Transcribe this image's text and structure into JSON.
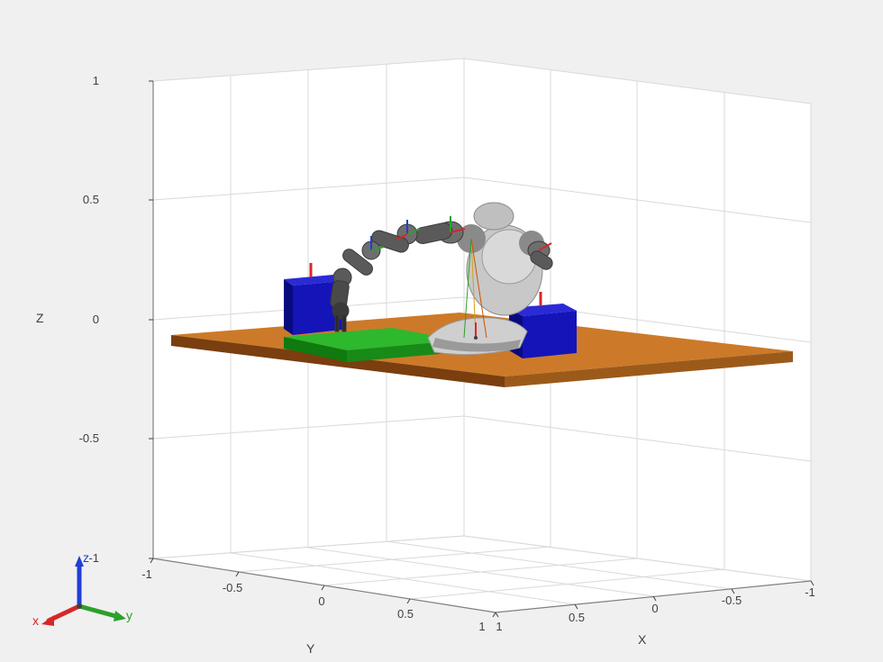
{
  "chart_data": {
    "type": "3d-scene",
    "xlabel": "X",
    "ylabel": "Y",
    "zlabel": "Z",
    "xlim": [
      -1,
      1
    ],
    "ylim": [
      -1,
      1
    ],
    "zlim": [
      -1,
      1
    ],
    "x_ticks": [
      -1,
      -0.5,
      0,
      0.5,
      1
    ],
    "y_ticks": [
      -1,
      -0.5,
      0,
      0.5,
      1
    ],
    "z_ticks": [
      -1,
      -0.5,
      0,
      0.5,
      1
    ],
    "extra_tick_near_origin": "1",
    "objects": [
      {
        "name": "ground-plane",
        "type": "box",
        "color": "#c46a1f",
        "center": [
          0,
          0,
          -0.02
        ],
        "size": [
          2.0,
          2.0,
          0.04
        ]
      },
      {
        "name": "green-platform",
        "type": "box",
        "color": "#2eb82e",
        "center": [
          0.25,
          0.25,
          0.02
        ],
        "size": [
          0.35,
          0.5,
          0.04
        ]
      },
      {
        "name": "green-platform-side",
        "type": "box",
        "color": "#0f8a0f",
        "center": [
          0.25,
          0.25,
          0.0
        ],
        "size": [
          0.35,
          0.5,
          0.02
        ]
      },
      {
        "name": "blue-box-left",
        "type": "box",
        "color": "#1414b8",
        "center": [
          0.2,
          0.6,
          0.1
        ],
        "size": [
          0.2,
          0.2,
          0.2
        ]
      },
      {
        "name": "blue-box-right",
        "type": "box",
        "color": "#1414b8",
        "center": [
          0.3,
          -0.35,
          0.08
        ],
        "size": [
          0.2,
          0.2,
          0.16
        ]
      },
      {
        "name": "robot-base",
        "type": "robot",
        "color": "#b8b8b8"
      }
    ],
    "corner_triad": {
      "x": {
        "label": "x",
        "color": "#d62728"
      },
      "y": {
        "label": "y",
        "color": "#2ca02c"
      },
      "z": {
        "label": "z",
        "color": "#1f3fd6"
      }
    }
  },
  "axes": {
    "xlabel": "X",
    "ylabel": "Y",
    "zlabel": "Z"
  }
}
